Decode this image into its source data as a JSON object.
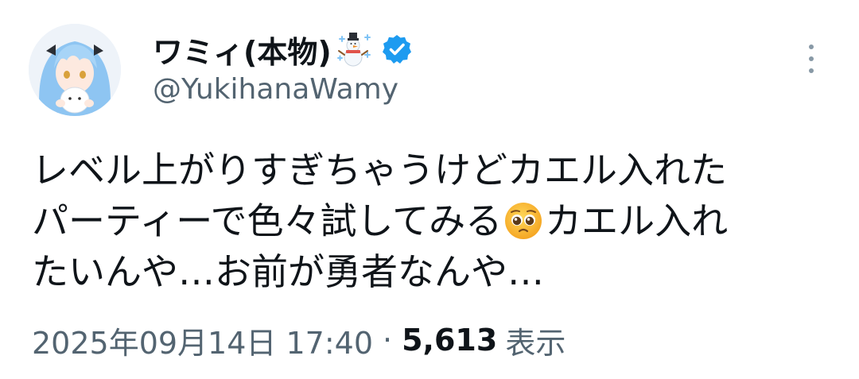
{
  "tweet": {
    "display_name": "ワミィ(本物)",
    "handle": "@YukihanaWamy",
    "verified": true,
    "name_emoji": "snowman-with-snow",
    "text_lines": [
      "レベル上がりすぎちゃうけどカエル入れた",
      "パーティーで色々試してみる",
      "カエル入れ",
      "たいんや…お前が勇者なんや…"
    ],
    "inline_emoji": "pleading-face",
    "timestamp": "2025年09月14日 17:40",
    "separator": "·",
    "view_count": "5,613",
    "view_label": "表示"
  },
  "colors": {
    "text": "#0f1419",
    "secondary": "#536471",
    "verified": "#1d9bf0",
    "background": "#ffffff"
  },
  "icons": {
    "more": "more-vertical-icon",
    "verified": "verified-badge-icon"
  }
}
